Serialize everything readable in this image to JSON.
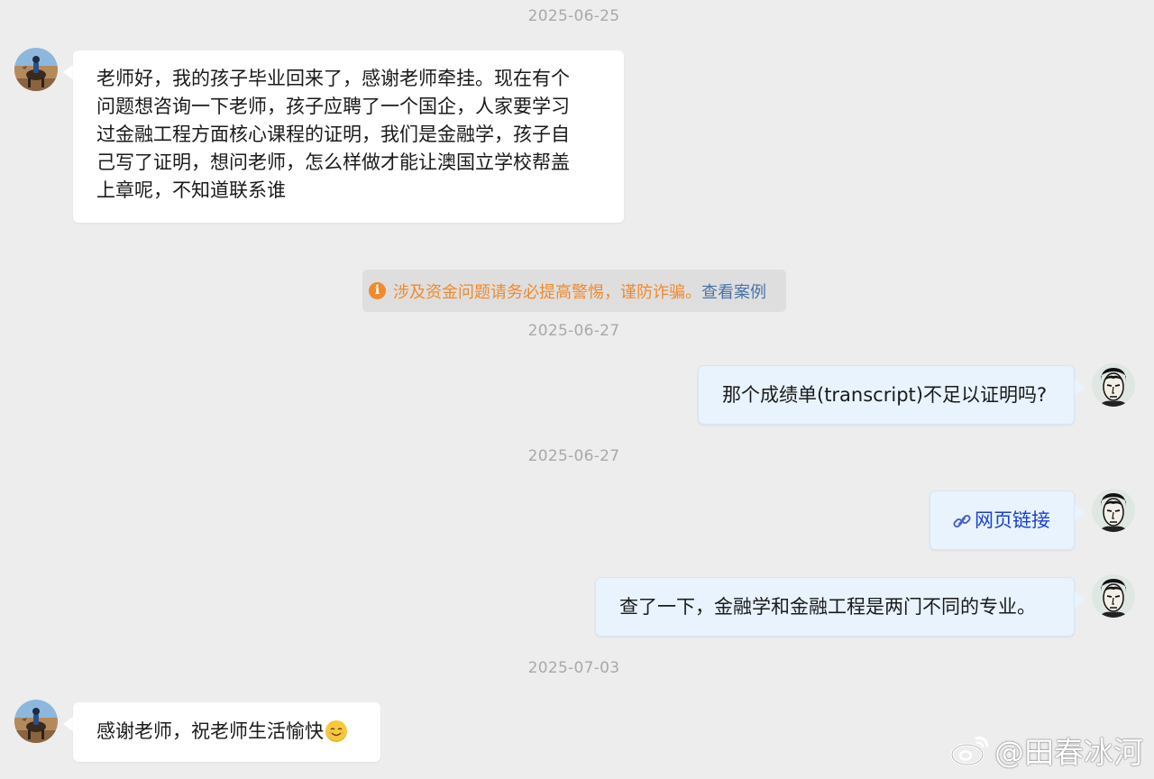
{
  "timestamps": [
    "2025-06-25",
    "2025-06-27",
    "2025-06-27",
    "2025-07-03"
  ],
  "messages": [
    {
      "side": "in",
      "lines": [
        "老师好，我的孩子毕业回来了，感谢老师牵挂。现在有个",
        "问题想咨询一下老师，孩子应聘了一个国企，人家要学习",
        "过金融工程方面核心课程的证明，我们是金融学，孩子自",
        "己写了证明，想问老师，怎么样做才能让澳国立学校帮盖",
        "上章呢，不知道联系谁"
      ]
    },
    {
      "side": "out",
      "text": "那个成绩单(transcript)不足以证明吗?"
    },
    {
      "side": "out",
      "text": "网页链接"
    },
    {
      "side": "out",
      "text": "查了一下，金融学和金融工程是两门不同的专业。"
    },
    {
      "side": "in",
      "text": "感谢老师，祝老师生活愉快"
    }
  ],
  "warning": {
    "text": "涉及资金问题请务必提高警惕，谨防诈骗。",
    "link": "查看案例"
  },
  "watermark": {
    "text": "@田春冰河"
  },
  "colors": {
    "background": "#ededed",
    "outgoing_bubble": "#e8f3fd",
    "warning_text": "#f08a2c",
    "link": "#1a3fd8"
  },
  "icons": [
    "info-icon",
    "link-icon",
    "smile-emoji-icon",
    "weibo-logo-icon"
  ]
}
